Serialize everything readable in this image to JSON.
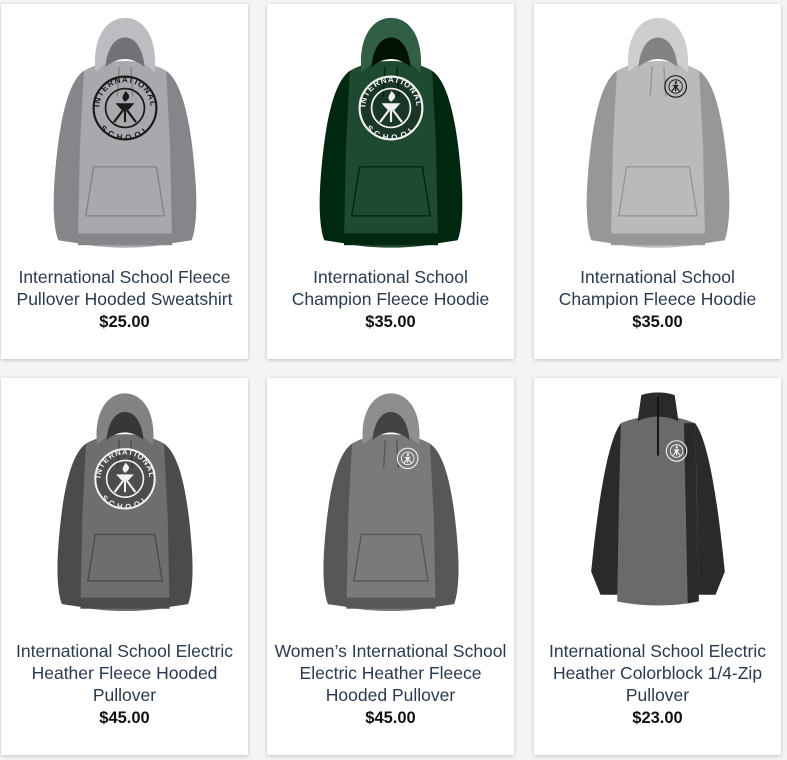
{
  "products": [
    {
      "title": "International School Fleece Pullover Hooded Sweatshirt",
      "price": "$25.00",
      "color": "#a7a9ac",
      "style": "hoodie",
      "logo": "large"
    },
    {
      "title": "International School Champion Fleece Hoodie",
      "price": "$35.00",
      "color": "#1f4a32",
      "style": "hoodie",
      "logo": "large-white"
    },
    {
      "title": "International School Champion Fleece Hoodie",
      "price": "$35.00",
      "color": "#b9babc",
      "style": "hoodie",
      "logo": "small"
    },
    {
      "title": "International School Electric Heather Fleece Hooded Pullover",
      "price": "$45.00",
      "color": "#6e6e6e",
      "style": "hoodie",
      "logo": "large-white"
    },
    {
      "title": "Women’s International School Electric Heather Fleece Hooded Pullover",
      "price": "$45.00",
      "color": "#7a7a7a",
      "style": "hoodie",
      "logo": "small-white"
    },
    {
      "title": "International School Electric Heather Colorblock 1/4-Zip Pullover",
      "price": "$23.00",
      "color": "#6a6a6a",
      "style": "quarterzip",
      "logo": "small-white"
    }
  ],
  "logo_text": {
    "top": "INTERNATIONAL",
    "bottom": "SCHOOL"
  }
}
